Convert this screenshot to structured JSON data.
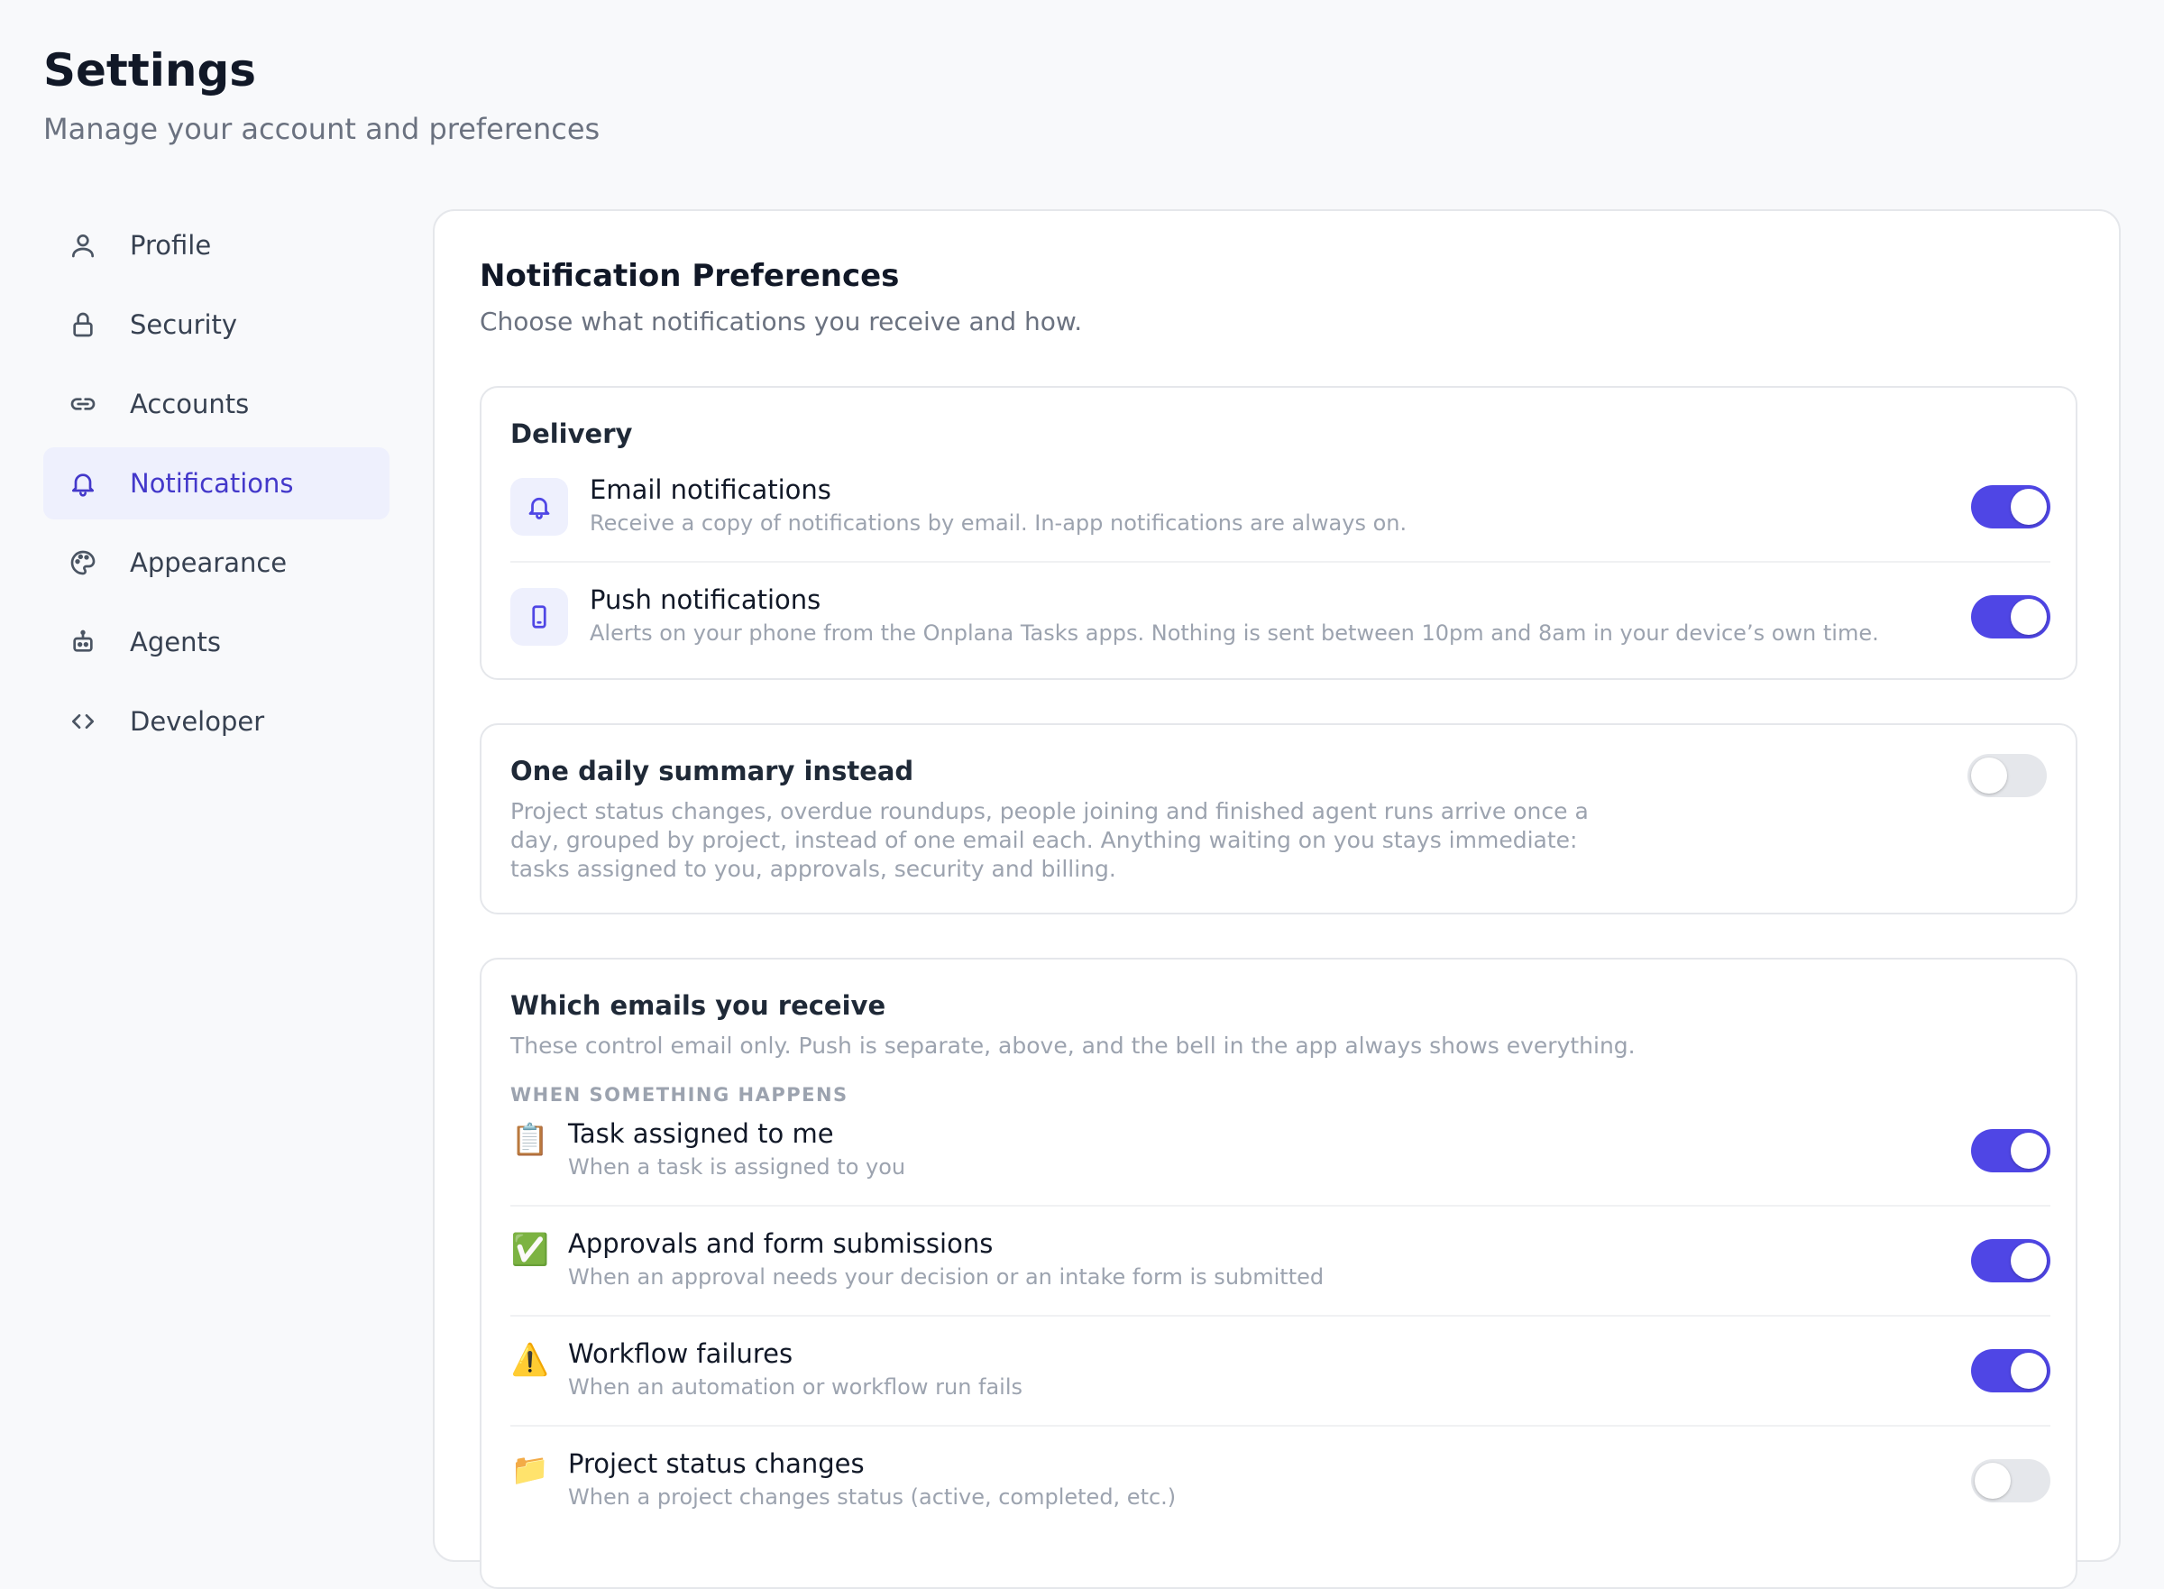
{
  "header": {
    "title": "Settings",
    "subtitle": "Manage your account and preferences"
  },
  "sidebar": {
    "items": [
      {
        "label": "Profile",
        "icon": "user-icon",
        "active": false
      },
      {
        "label": "Security",
        "icon": "lock-icon",
        "active": false
      },
      {
        "label": "Accounts",
        "icon": "link-icon",
        "active": false
      },
      {
        "label": "Notifications",
        "icon": "bell-icon",
        "active": true
      },
      {
        "label": "Appearance",
        "icon": "palette-icon",
        "active": false
      },
      {
        "label": "Agents",
        "icon": "robot-icon",
        "active": false
      },
      {
        "label": "Developer",
        "icon": "code-icon",
        "active": false
      }
    ]
  },
  "panel": {
    "title": "Notification Preferences",
    "subtitle": "Choose what notifications you receive and how."
  },
  "delivery": {
    "title": "Delivery",
    "rows": [
      {
        "title": "Email notifications",
        "desc": "Receive a copy of notifications by email. In-app notifications are always on.",
        "icon": "bell-icon",
        "enabled": true
      },
      {
        "title": "Push notifications",
        "desc": "Alerts on your phone from the Onplana Tasks apps. Nothing is sent between 10pm and 8am in your device’s own time.",
        "icon": "phone-icon",
        "enabled": true
      }
    ]
  },
  "daily_summary": {
    "title": "One daily summary instead",
    "desc_lines": [
      "Project status changes, overdue roundups, people joining and finished agent runs arrive once a",
      "day, grouped by project, instead of one email each. Anything waiting on you stays immediate:",
      "tasks assigned to you, approvals, security and billing."
    ],
    "enabled": false
  },
  "emails": {
    "title": "Which emails you receive",
    "desc": "These control email only. Push is separate, above, and the bell in the app always shows everything.",
    "section_label": "WHEN SOMETHING HAPPENS",
    "rows": [
      {
        "emoji": "📋",
        "title": "Task assigned to me",
        "desc": "When a task is assigned to you",
        "enabled": true
      },
      {
        "emoji": "✅",
        "title": "Approvals and form submissions",
        "desc": "When an approval needs your decision or an intake form is submitted",
        "enabled": true
      },
      {
        "emoji": "⚠️",
        "title": "Workflow failures",
        "desc": "When an automation or workflow run fails",
        "enabled": true
      },
      {
        "emoji": "📁",
        "title": "Project status changes",
        "desc": "When a project changes status (active, completed, etc.)",
        "enabled": false
      }
    ]
  },
  "colors": {
    "accent": "#4f46e5",
    "active_nav_bg": "#eef0fd",
    "active_nav_text": "#4338ca",
    "toggle_off": "#e5e7eb"
  }
}
